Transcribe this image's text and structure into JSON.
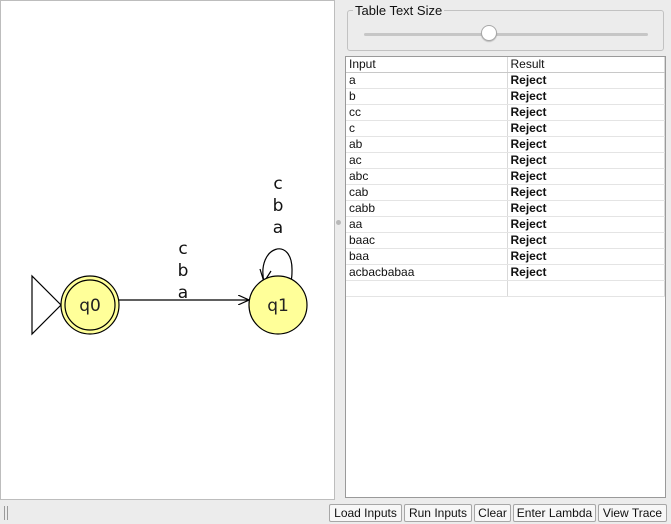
{
  "automaton": {
    "states": [
      {
        "id": "q0",
        "label": "q0",
        "initial": true,
        "final": true
      },
      {
        "id": "q1",
        "label": "q1",
        "initial": false,
        "final": false
      }
    ],
    "transitions": [
      {
        "from": "q0",
        "to": "q1",
        "labels": [
          "c",
          "b",
          "a"
        ]
      },
      {
        "from": "q1",
        "to": "q1",
        "labels": [
          "c",
          "b",
          "a"
        ]
      }
    ],
    "state_fill": "#ffff99",
    "state_stroke": "#000000"
  },
  "table_text_size": {
    "title": "Table Text Size",
    "value_fraction": 0.44
  },
  "results_table": {
    "headers": [
      "Input",
      "Result"
    ],
    "rows": [
      [
        "a",
        "Reject"
      ],
      [
        "b",
        "Reject"
      ],
      [
        "cc",
        "Reject"
      ],
      [
        "c",
        "Reject"
      ],
      [
        "ab",
        "Reject"
      ],
      [
        "ac",
        "Reject"
      ],
      [
        "abc",
        "Reject"
      ],
      [
        "cab",
        "Reject"
      ],
      [
        "cabb",
        "Reject"
      ],
      [
        "aa",
        "Reject"
      ],
      [
        "baac",
        "Reject"
      ],
      [
        "baa",
        "Reject"
      ],
      [
        "acbacbabaa",
        "Reject"
      ],
      [
        "",
        ""
      ]
    ]
  },
  "buttons": {
    "load_inputs": "Load Inputs",
    "run_inputs": "Run Inputs",
    "clear": "Clear",
    "enter_lambda": "Enter Lambda",
    "view_trace": "View Trace"
  }
}
